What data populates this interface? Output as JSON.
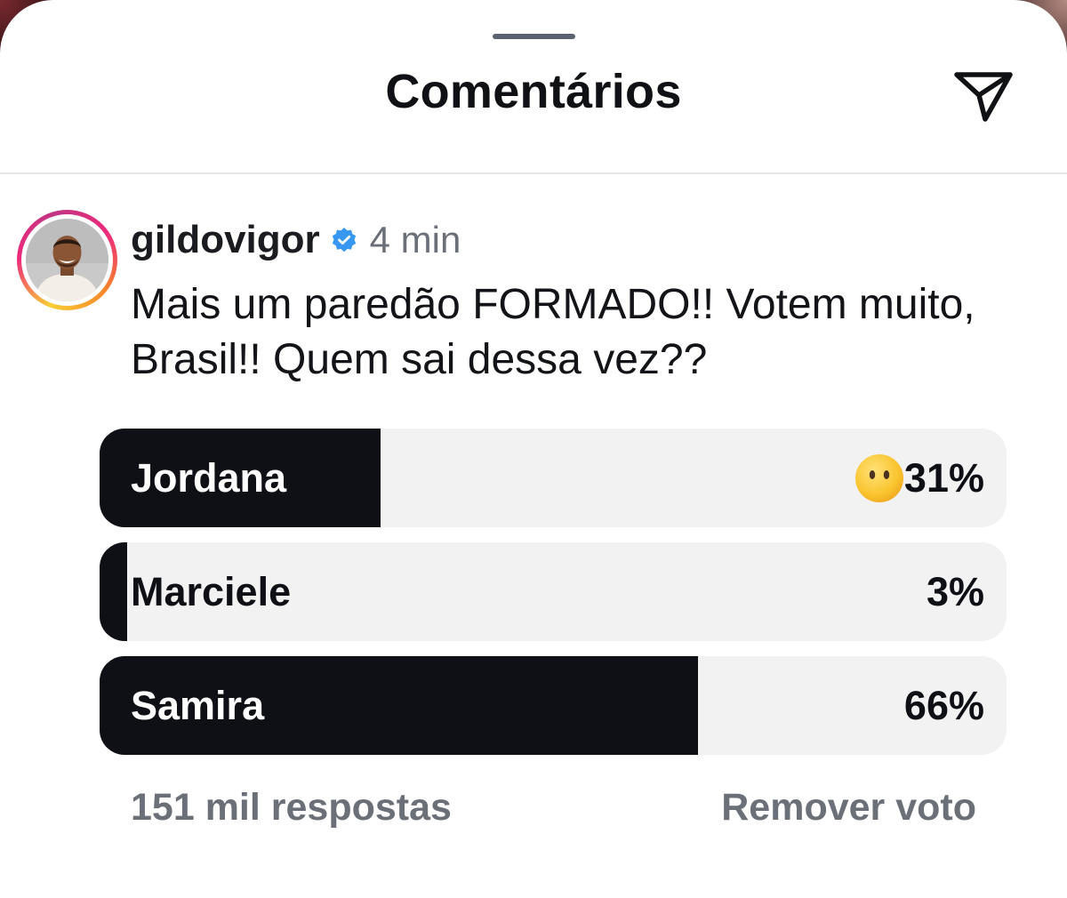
{
  "header": {
    "title": "Comentários",
    "share_icon": "send-paper-plane-icon"
  },
  "comment": {
    "username": "gildovigor",
    "verified": true,
    "time": "4 min",
    "text": "Mais um paredão FORMADO!! Votem muito, Brasil!! Quem sai dessa vez??"
  },
  "poll": {
    "options": [
      {
        "label": "Jordana",
        "percent_text": "31%",
        "percent": 31,
        "selected": true,
        "emoji": "face-without-mouth"
      },
      {
        "label": "Marciele",
        "percent_text": "3%",
        "percent": 3,
        "selected": false
      },
      {
        "label": "Samira",
        "percent_text": "66%",
        "percent": 66,
        "selected": false
      }
    ],
    "responses": "151 mil respostas",
    "remove_vote": "Remover voto"
  },
  "colors": {
    "bar_fill": "#0e1015",
    "bar_track": "#f2f2f3",
    "verified_blue": "#3897f0",
    "muted_text": "#6b7078"
  }
}
